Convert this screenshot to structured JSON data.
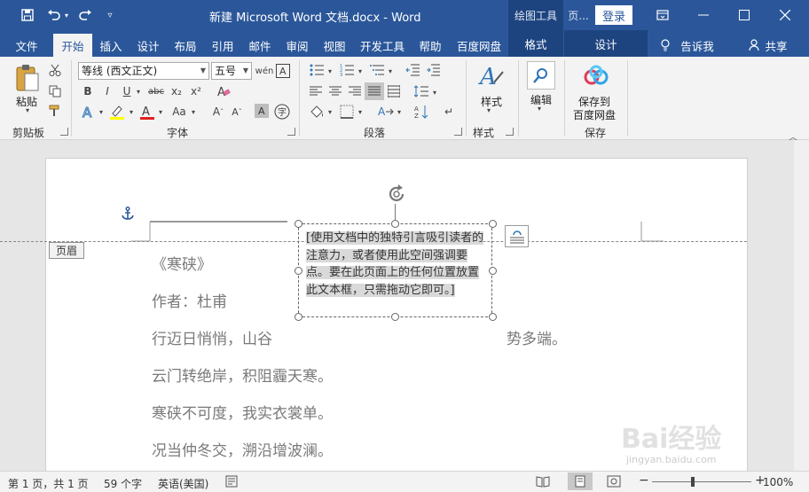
{
  "window": {
    "title": "新建 Microsoft Word 文档.docx  -  Word",
    "context_tools": [
      "绘图工具",
      "页..."
    ],
    "login": "登录"
  },
  "tabs": [
    "文件",
    "开始",
    "插入",
    "设计",
    "布局",
    "引用",
    "邮件",
    "审阅",
    "视图",
    "开发工具",
    "帮助",
    "百度网盘"
  ],
  "active_tab": "开始",
  "context_tabs": [
    "格式",
    "设计"
  ],
  "tell_me": "告诉我",
  "share": "共享",
  "ribbon": {
    "clipboard": {
      "paste": "粘贴",
      "label": "剪贴板"
    },
    "font": {
      "name": "等线 (西文正文)",
      "size": "五号",
      "label": "字体"
    },
    "paragraph": {
      "label": "段落"
    },
    "styles": {
      "button": "样式",
      "label": "样式"
    },
    "editing": {
      "button": "编辑"
    },
    "save": {
      "button_line1": "保存到",
      "button_line2": "百度网盘",
      "label": "保存"
    }
  },
  "document": {
    "header_tag": "页眉",
    "lines": [
      "《寒硖》",
      "作者：杜甫",
      "行迈日悄悄，山谷",
      "云门转绝岸，积阻霾天寒。",
      "寒硖不可度，我实衣裳单。",
      "况当仲冬交，溯沿增波澜。"
    ],
    "line3_tail": "势多端。",
    "textbox": "[使用文档中的独特引言吸引读者的注意力，或者使用此空间强调要点。要在此页面上的任何位置放置此文本框，只需拖动它即可。]"
  },
  "status": {
    "page": "第 1 页，共 1 页",
    "words": "59 个字",
    "language": "英语(美国)",
    "zoom": "100%"
  },
  "watermark": {
    "main": "Bai经验",
    "sub": "jingyan.baidu.com"
  }
}
